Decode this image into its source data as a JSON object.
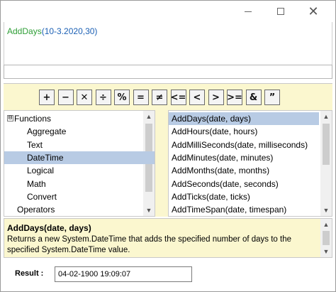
{
  "window": {
    "min_icon": "minimize-icon",
    "max_icon": "maximize-icon",
    "close_symbol": "✕"
  },
  "expression": {
    "function_name": "AddDays",
    "arguments": "(10-3.2020,30)"
  },
  "operators": [
    "+",
    "−",
    "✕",
    "÷",
    "%",
    "=",
    "≠",
    "<=",
    "<",
    ">",
    ">=",
    "&",
    "”"
  ],
  "tree": {
    "expander_symbol": "⊟",
    "items": [
      {
        "label": "Functions"
      },
      {
        "label": "Aggregate"
      },
      {
        "label": "Text"
      },
      {
        "label": "DateTime"
      },
      {
        "label": "Logical"
      },
      {
        "label": "Math"
      },
      {
        "label": "Convert"
      },
      {
        "label": "Operators"
      }
    ]
  },
  "functions": [
    "AddDays(date, days)",
    "AddHours(date, hours)",
    "AddMilliSeconds(date, milliseconds)",
    "AddMinutes(date, minutes)",
    "AddMonths(date, months)",
    "AddSeconds(date, seconds)",
    "AddTicks(date, ticks)",
    "AddTimeSpan(date, timespan)"
  ],
  "description": {
    "title": "AddDays(date, days)",
    "body": "Returns a new System.DateTime that adds the specified number of days to the specified System.DateTime value."
  },
  "result": {
    "label": "Result :",
    "value": "04-02-1900 19:09:07"
  },
  "colors": {
    "function_green": "#2e9e36",
    "argument_blue": "#1a5fb4",
    "panel_yellow": "#fbf7cf",
    "selection_blue": "#b8cbe4"
  }
}
